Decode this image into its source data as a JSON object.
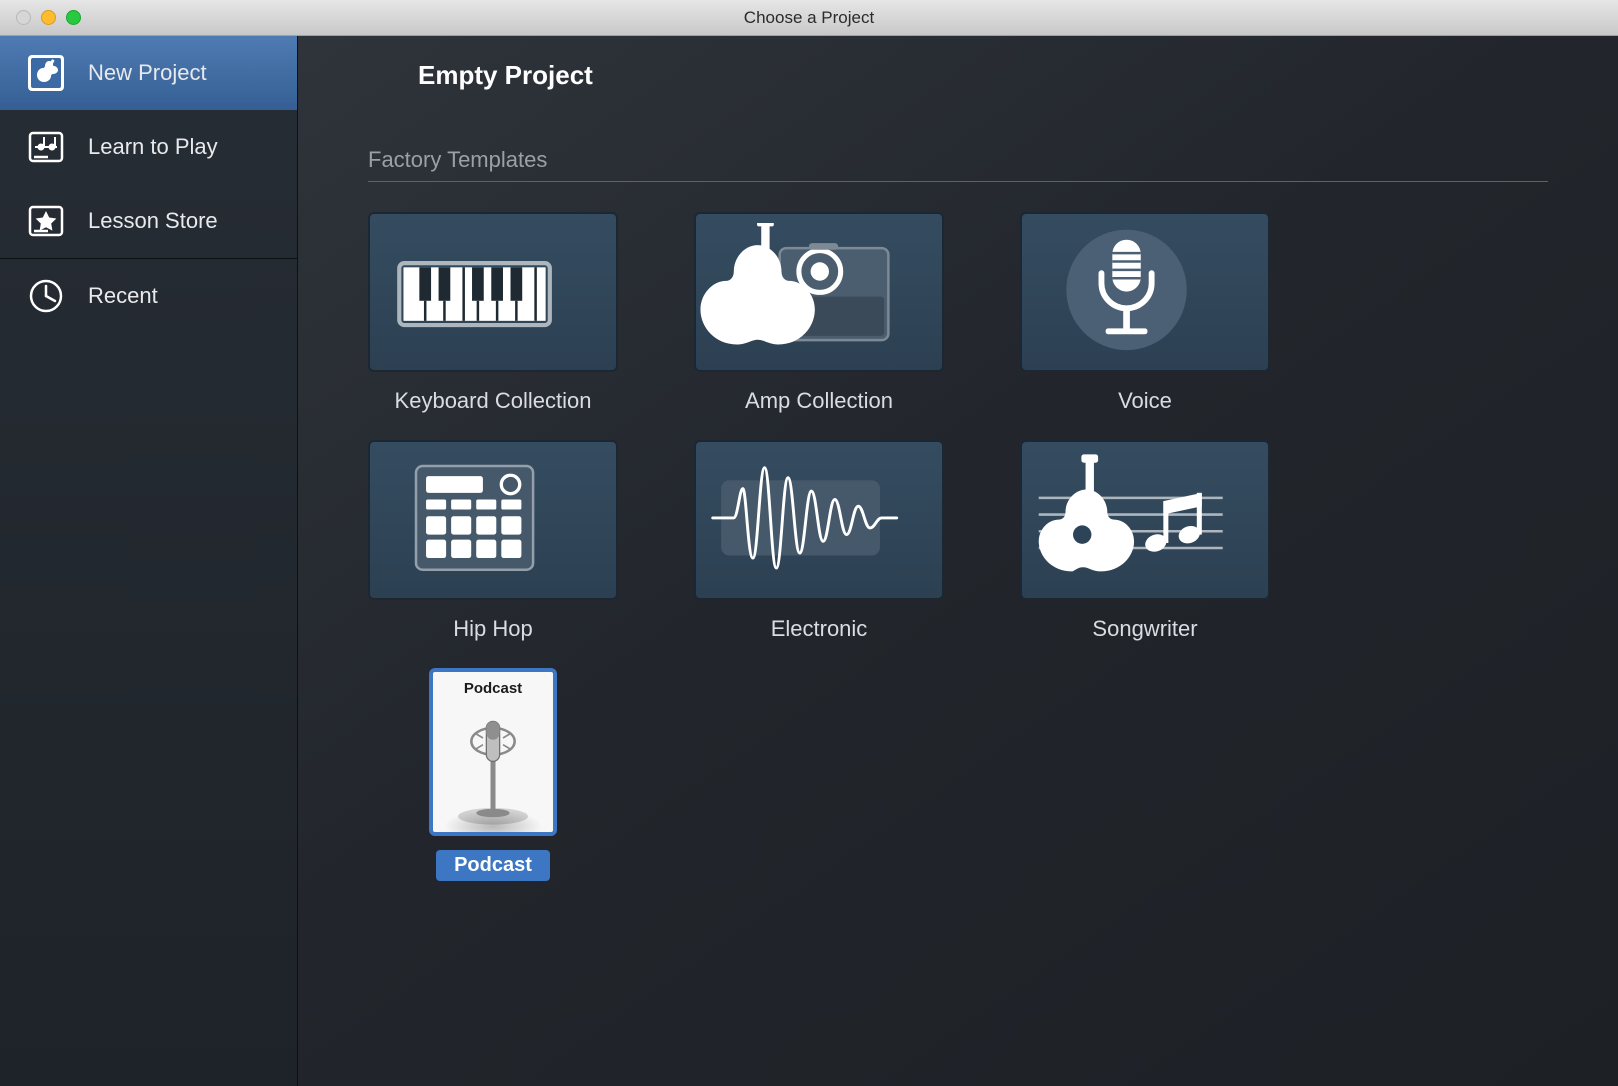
{
  "window": {
    "title": "Choose a Project"
  },
  "sidebar": {
    "items": [
      {
        "id": "new-project",
        "label": "New Project",
        "icon": "guitar-tile-icon",
        "selected": true
      },
      {
        "id": "learn-to-play",
        "label": "Learn to Play",
        "icon": "sheet-music-icon",
        "selected": false
      },
      {
        "id": "lesson-store",
        "label": "Lesson Store",
        "icon": "star-badge-icon",
        "selected": false
      },
      {
        "id": "recent",
        "label": "Recent",
        "icon": "clock-icon",
        "selected": false
      }
    ]
  },
  "main": {
    "header": "Empty Project",
    "section_title": "Factory Templates",
    "templates": [
      {
        "id": "keyboard-collection",
        "label": "Keyboard Collection",
        "icon": "piano-keys-icon"
      },
      {
        "id": "amp-collection",
        "label": "Amp Collection",
        "icon": "guitar-amp-icon"
      },
      {
        "id": "voice",
        "label": "Voice",
        "icon": "microphone-icon"
      },
      {
        "id": "hip-hop",
        "label": "Hip Hop",
        "icon": "drum-machine-icon"
      },
      {
        "id": "electronic",
        "label": "Electronic",
        "icon": "waveform-icon"
      },
      {
        "id": "songwriter",
        "label": "Songwriter",
        "icon": "acoustic-notes-icon"
      },
      {
        "id": "podcast",
        "label": "Podcast",
        "icon": "studio-mic-icon",
        "selected": true,
        "inner_title": "Podcast"
      }
    ]
  }
}
